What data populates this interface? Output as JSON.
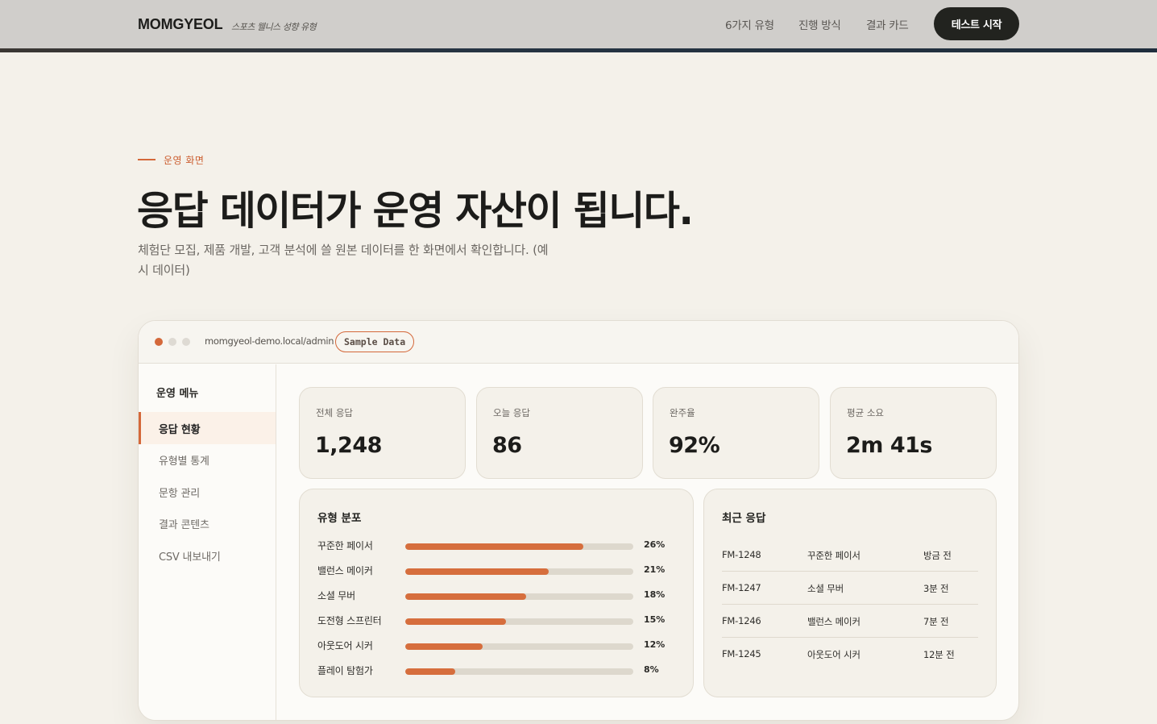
{
  "header": {
    "brand": "MOMGYEOL",
    "brand_sub": "스포츠 웰니스 성향 유형",
    "nav": [
      "6가지 유형",
      "진행 방식",
      "결과 카드"
    ],
    "cta": "테스트 시작"
  },
  "hero": {
    "eyebrow": "운영 화면",
    "title": "응답 데이터가 운영 자산이 됩니다.",
    "lead": "체험단 모집, 제품 개발, 고객 분석에 쓸 원본 데이터를 한 화면에서 확인합니다. (예시 데이터)"
  },
  "window": {
    "url": "momgyeol-demo.local/admin",
    "badge": "Sample Data",
    "dot_colors": [
      "#d4683a",
      "#dedad3",
      "#dedad3"
    ]
  },
  "sidebar": {
    "title": "운영 메뉴",
    "items": [
      "응답 현황",
      "유형별 통계",
      "문항 관리",
      "결과 콘텐츠",
      "CSV 내보내기"
    ],
    "active_index": 0
  },
  "stats": [
    {
      "label": "전체 응답",
      "value": "1,248"
    },
    {
      "label": "오늘 응답",
      "value": "86"
    },
    {
      "label": "완주율",
      "value": "92%"
    },
    {
      "label": "평균 소요",
      "value": "2m 41s"
    }
  ],
  "distribution": {
    "title": "유형 분포",
    "items": [
      {
        "name": "꾸준한 페이서",
        "pct": "26%",
        "fill": 0.78
      },
      {
        "name": "밸런스 메이커",
        "pct": "21%",
        "fill": 0.63
      },
      {
        "name": "소셜 무버",
        "pct": "18%",
        "fill": 0.53
      },
      {
        "name": "도전형 스프린터",
        "pct": "15%",
        "fill": 0.44
      },
      {
        "name": "아웃도어 시커",
        "pct": "12%",
        "fill": 0.34
      },
      {
        "name": "플레이 탐험가",
        "pct": "8%",
        "fill": 0.22
      }
    ]
  },
  "recent": {
    "title": "최근 응답",
    "rows": [
      {
        "id": "FM-1248",
        "type": "꾸준한 페이서",
        "time": "방금 전"
      },
      {
        "id": "FM-1247",
        "type": "소셜 무버",
        "time": "3분 전"
      },
      {
        "id": "FM-1246",
        "type": "밸런스 메이커",
        "time": "7분 전"
      },
      {
        "id": "FM-1245",
        "type": "아웃도어 시커",
        "time": "12분 전"
      }
    ]
  },
  "colors": {
    "accent": "#d4683a",
    "dark": "#22231f",
    "background": "#f4f1ea"
  }
}
